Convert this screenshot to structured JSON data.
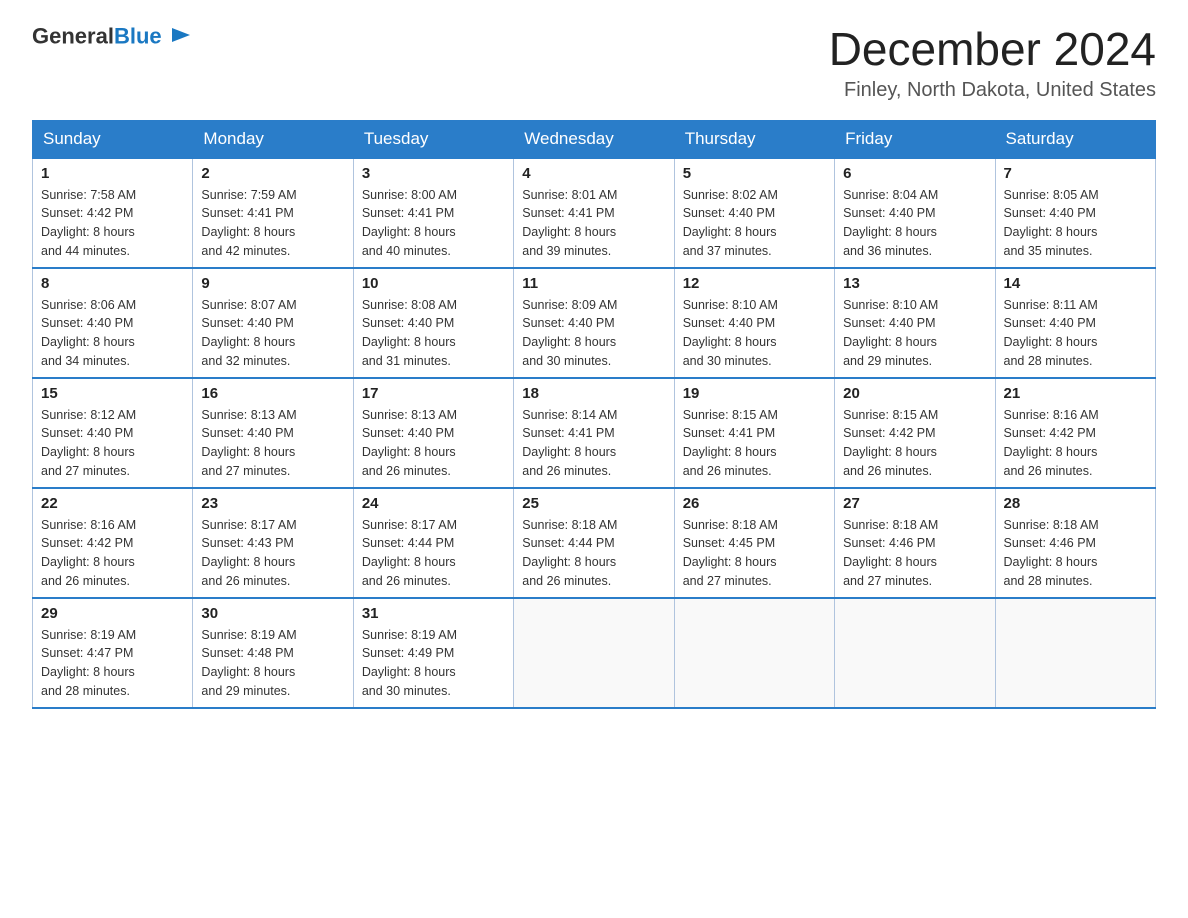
{
  "header": {
    "logo_general": "General",
    "logo_blue": "Blue",
    "month_title": "December 2024",
    "location": "Finley, North Dakota, United States"
  },
  "days_of_week": [
    "Sunday",
    "Monday",
    "Tuesday",
    "Wednesday",
    "Thursday",
    "Friday",
    "Saturday"
  ],
  "weeks": [
    [
      {
        "day": "1",
        "sunrise": "7:58 AM",
        "sunset": "4:42 PM",
        "daylight": "8 hours and 44 minutes."
      },
      {
        "day": "2",
        "sunrise": "7:59 AM",
        "sunset": "4:41 PM",
        "daylight": "8 hours and 42 minutes."
      },
      {
        "day": "3",
        "sunrise": "8:00 AM",
        "sunset": "4:41 PM",
        "daylight": "8 hours and 40 minutes."
      },
      {
        "day": "4",
        "sunrise": "8:01 AM",
        "sunset": "4:41 PM",
        "daylight": "8 hours and 39 minutes."
      },
      {
        "day": "5",
        "sunrise": "8:02 AM",
        "sunset": "4:40 PM",
        "daylight": "8 hours and 37 minutes."
      },
      {
        "day": "6",
        "sunrise": "8:04 AM",
        "sunset": "4:40 PM",
        "daylight": "8 hours and 36 minutes."
      },
      {
        "day": "7",
        "sunrise": "8:05 AM",
        "sunset": "4:40 PM",
        "daylight": "8 hours and 35 minutes."
      }
    ],
    [
      {
        "day": "8",
        "sunrise": "8:06 AM",
        "sunset": "4:40 PM",
        "daylight": "8 hours and 34 minutes."
      },
      {
        "day": "9",
        "sunrise": "8:07 AM",
        "sunset": "4:40 PM",
        "daylight": "8 hours and 32 minutes."
      },
      {
        "day": "10",
        "sunrise": "8:08 AM",
        "sunset": "4:40 PM",
        "daylight": "8 hours and 31 minutes."
      },
      {
        "day": "11",
        "sunrise": "8:09 AM",
        "sunset": "4:40 PM",
        "daylight": "8 hours and 30 minutes."
      },
      {
        "day": "12",
        "sunrise": "8:10 AM",
        "sunset": "4:40 PM",
        "daylight": "8 hours and 30 minutes."
      },
      {
        "day": "13",
        "sunrise": "8:10 AM",
        "sunset": "4:40 PM",
        "daylight": "8 hours and 29 minutes."
      },
      {
        "day": "14",
        "sunrise": "8:11 AM",
        "sunset": "4:40 PM",
        "daylight": "8 hours and 28 minutes."
      }
    ],
    [
      {
        "day": "15",
        "sunrise": "8:12 AM",
        "sunset": "4:40 PM",
        "daylight": "8 hours and 27 minutes."
      },
      {
        "day": "16",
        "sunrise": "8:13 AM",
        "sunset": "4:40 PM",
        "daylight": "8 hours and 27 minutes."
      },
      {
        "day": "17",
        "sunrise": "8:13 AM",
        "sunset": "4:40 PM",
        "daylight": "8 hours and 26 minutes."
      },
      {
        "day": "18",
        "sunrise": "8:14 AM",
        "sunset": "4:41 PM",
        "daylight": "8 hours and 26 minutes."
      },
      {
        "day": "19",
        "sunrise": "8:15 AM",
        "sunset": "4:41 PM",
        "daylight": "8 hours and 26 minutes."
      },
      {
        "day": "20",
        "sunrise": "8:15 AM",
        "sunset": "4:42 PM",
        "daylight": "8 hours and 26 minutes."
      },
      {
        "day": "21",
        "sunrise": "8:16 AM",
        "sunset": "4:42 PM",
        "daylight": "8 hours and 26 minutes."
      }
    ],
    [
      {
        "day": "22",
        "sunrise": "8:16 AM",
        "sunset": "4:42 PM",
        "daylight": "8 hours and 26 minutes."
      },
      {
        "day": "23",
        "sunrise": "8:17 AM",
        "sunset": "4:43 PM",
        "daylight": "8 hours and 26 minutes."
      },
      {
        "day": "24",
        "sunrise": "8:17 AM",
        "sunset": "4:44 PM",
        "daylight": "8 hours and 26 minutes."
      },
      {
        "day": "25",
        "sunrise": "8:18 AM",
        "sunset": "4:44 PM",
        "daylight": "8 hours and 26 minutes."
      },
      {
        "day": "26",
        "sunrise": "8:18 AM",
        "sunset": "4:45 PM",
        "daylight": "8 hours and 27 minutes."
      },
      {
        "day": "27",
        "sunrise": "8:18 AM",
        "sunset": "4:46 PM",
        "daylight": "8 hours and 27 minutes."
      },
      {
        "day": "28",
        "sunrise": "8:18 AM",
        "sunset": "4:46 PM",
        "daylight": "8 hours and 28 minutes."
      }
    ],
    [
      {
        "day": "29",
        "sunrise": "8:19 AM",
        "sunset": "4:47 PM",
        "daylight": "8 hours and 28 minutes."
      },
      {
        "day": "30",
        "sunrise": "8:19 AM",
        "sunset": "4:48 PM",
        "daylight": "8 hours and 29 minutes."
      },
      {
        "day": "31",
        "sunrise": "8:19 AM",
        "sunset": "4:49 PM",
        "daylight": "8 hours and 30 minutes."
      },
      null,
      null,
      null,
      null
    ]
  ],
  "labels": {
    "sunrise": "Sunrise:",
    "sunset": "Sunset:",
    "daylight": "Daylight:"
  }
}
